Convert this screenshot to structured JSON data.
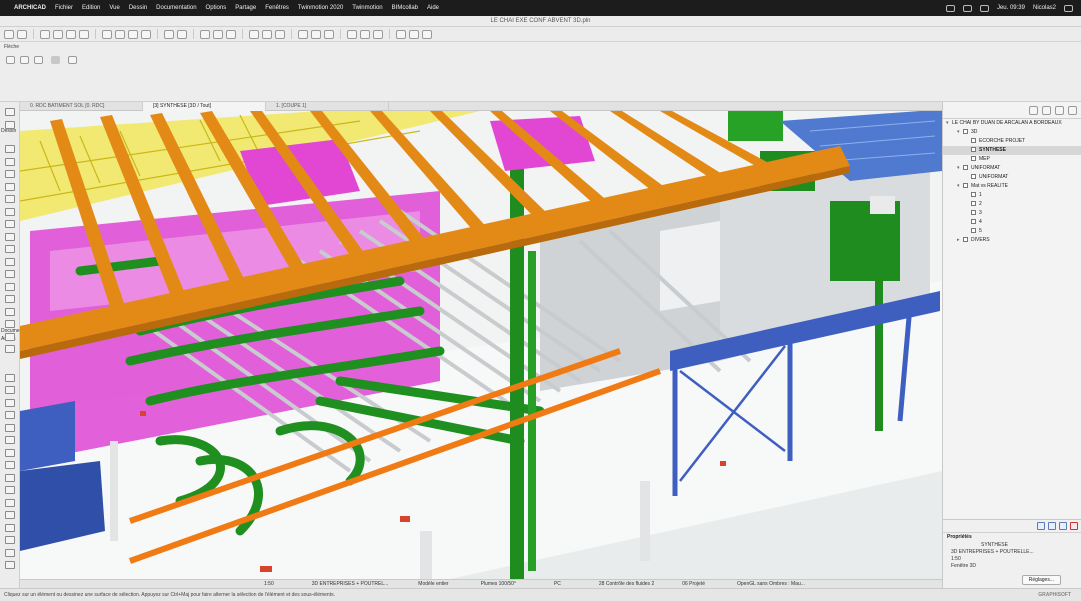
{
  "menubar": {
    "app": "ARCHICAD",
    "items": [
      "Fichier",
      "Edition",
      "Vue",
      "Dessin",
      "Documentation",
      "Options",
      "Partage",
      "Fenêtres",
      "Twinmotion 2020",
      "Twinmotion",
      "BIMcollab",
      "Aide"
    ],
    "clock": "Jeu. 09:39",
    "user": "Nicolas2"
  },
  "window": {
    "title": "LE CHAI EXE CONF ABVENT 3D.pln",
    "infobox_label": "Flèche"
  },
  "toolbox": {
    "section_design": "Dessin",
    "section_doc": "Docume",
    "section_more": "Autres"
  },
  "tabs": [
    "0. RDC BATIMENT SOL [0. RDC]",
    "[3] SYNTHESE [3D / Tout]",
    "1. [COUPE 1]"
  ],
  "navigator": {
    "project": "LE CHAI BY DUAN DE ARCALAN A BORDEAUX",
    "items": [
      {
        "label": "3D",
        "level": 1,
        "arrow": "▾",
        "check": true,
        "sel": false
      },
      {
        "label": "ECORCHE PROJET",
        "level": 2,
        "arrow": "",
        "check": true,
        "sel": false
      },
      {
        "label": "SYNTHESE",
        "level": 2,
        "arrow": "",
        "check": true,
        "sel": true
      },
      {
        "label": "MEP",
        "level": 2,
        "arrow": "",
        "check": true,
        "sel": false
      },
      {
        "label": "UNIFORMAT",
        "level": 1,
        "arrow": "▾",
        "check": true,
        "sel": false
      },
      {
        "label": "UNIFORMAT",
        "level": 2,
        "arrow": "",
        "check": true,
        "sel": false
      },
      {
        "label": "Mat vs REALITE",
        "level": 1,
        "arrow": "▾",
        "check": true,
        "sel": false
      },
      {
        "label": "1",
        "level": 2,
        "arrow": "",
        "check": true,
        "sel": false
      },
      {
        "label": "2",
        "level": 2,
        "arrow": "",
        "check": true,
        "sel": false
      },
      {
        "label": "3",
        "level": 2,
        "arrow": "",
        "check": true,
        "sel": false
      },
      {
        "label": "4",
        "level": 2,
        "arrow": "",
        "check": true,
        "sel": false
      },
      {
        "label": "5",
        "level": 2,
        "arrow": "",
        "check": true,
        "sel": false
      },
      {
        "label": "DIVERS",
        "level": 1,
        "arrow": "▸",
        "check": true,
        "sel": false
      }
    ]
  },
  "properties": {
    "title": "Propriétés",
    "name": "SYNTHESE",
    "lines": [
      "3D ENTREPRISES + POUTRELLE...",
      "1:50",
      "Fenêtre 3D"
    ],
    "button": "Réglages..."
  },
  "statusbar": {
    "cells": [
      "1:50",
      "3D ENTREPRISES + POUTREL...",
      "Modèle entier",
      "Plumes 100/50°",
      "PC",
      "28 Contrôle des fluides 2",
      "06 Projeté",
      "OpenGL sans Ombres : Mau..."
    ],
    "hint": "Cliquez sur un élément ou dessinez une surface de sélection. Appuyez sur Ctrl+Maj pour faire alterner la sélection de l'élément et des sous-éléments.",
    "brand": "GRAPHISOFT"
  },
  "colors": {
    "beam_orange": "#e38a16",
    "duct_green": "#1f8f1f",
    "pink_wall": "#df4fd6",
    "steel_blue": "#3e5fbf",
    "slab_white": "#f6f7f7"
  }
}
